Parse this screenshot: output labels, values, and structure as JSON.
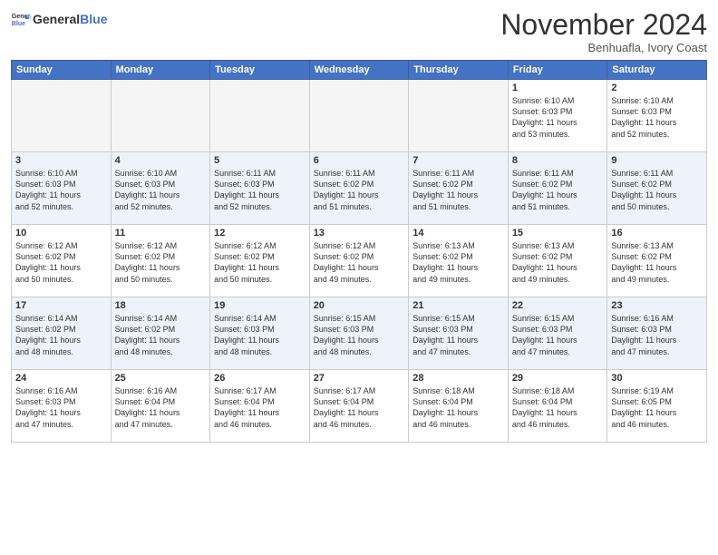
{
  "header": {
    "logo_line1": "General",
    "logo_line2": "Blue",
    "month": "November 2024",
    "location": "Benhuafla, Ivory Coast"
  },
  "weekdays": [
    "Sunday",
    "Monday",
    "Tuesday",
    "Wednesday",
    "Thursday",
    "Friday",
    "Saturday"
  ],
  "weeks": [
    [
      {
        "day": "",
        "info": ""
      },
      {
        "day": "",
        "info": ""
      },
      {
        "day": "",
        "info": ""
      },
      {
        "day": "",
        "info": ""
      },
      {
        "day": "",
        "info": ""
      },
      {
        "day": "1",
        "info": "Sunrise: 6:10 AM\nSunset: 6:03 PM\nDaylight: 11 hours\nand 53 minutes."
      },
      {
        "day": "2",
        "info": "Sunrise: 6:10 AM\nSunset: 6:03 PM\nDaylight: 11 hours\nand 52 minutes."
      }
    ],
    [
      {
        "day": "3",
        "info": "Sunrise: 6:10 AM\nSunset: 6:03 PM\nDaylight: 11 hours\nand 52 minutes."
      },
      {
        "day": "4",
        "info": "Sunrise: 6:10 AM\nSunset: 6:03 PM\nDaylight: 11 hours\nand 52 minutes."
      },
      {
        "day": "5",
        "info": "Sunrise: 6:11 AM\nSunset: 6:03 PM\nDaylight: 11 hours\nand 52 minutes."
      },
      {
        "day": "6",
        "info": "Sunrise: 6:11 AM\nSunset: 6:02 PM\nDaylight: 11 hours\nand 51 minutes."
      },
      {
        "day": "7",
        "info": "Sunrise: 6:11 AM\nSunset: 6:02 PM\nDaylight: 11 hours\nand 51 minutes."
      },
      {
        "day": "8",
        "info": "Sunrise: 6:11 AM\nSunset: 6:02 PM\nDaylight: 11 hours\nand 51 minutes."
      },
      {
        "day": "9",
        "info": "Sunrise: 6:11 AM\nSunset: 6:02 PM\nDaylight: 11 hours\nand 50 minutes."
      }
    ],
    [
      {
        "day": "10",
        "info": "Sunrise: 6:12 AM\nSunset: 6:02 PM\nDaylight: 11 hours\nand 50 minutes."
      },
      {
        "day": "11",
        "info": "Sunrise: 6:12 AM\nSunset: 6:02 PM\nDaylight: 11 hours\nand 50 minutes."
      },
      {
        "day": "12",
        "info": "Sunrise: 6:12 AM\nSunset: 6:02 PM\nDaylight: 11 hours\nand 50 minutes."
      },
      {
        "day": "13",
        "info": "Sunrise: 6:12 AM\nSunset: 6:02 PM\nDaylight: 11 hours\nand 49 minutes."
      },
      {
        "day": "14",
        "info": "Sunrise: 6:13 AM\nSunset: 6:02 PM\nDaylight: 11 hours\nand 49 minutes."
      },
      {
        "day": "15",
        "info": "Sunrise: 6:13 AM\nSunset: 6:02 PM\nDaylight: 11 hours\nand 49 minutes."
      },
      {
        "day": "16",
        "info": "Sunrise: 6:13 AM\nSunset: 6:02 PM\nDaylight: 11 hours\nand 49 minutes."
      }
    ],
    [
      {
        "day": "17",
        "info": "Sunrise: 6:14 AM\nSunset: 6:02 PM\nDaylight: 11 hours\nand 48 minutes."
      },
      {
        "day": "18",
        "info": "Sunrise: 6:14 AM\nSunset: 6:02 PM\nDaylight: 11 hours\nand 48 minutes."
      },
      {
        "day": "19",
        "info": "Sunrise: 6:14 AM\nSunset: 6:03 PM\nDaylight: 11 hours\nand 48 minutes."
      },
      {
        "day": "20",
        "info": "Sunrise: 6:15 AM\nSunset: 6:03 PM\nDaylight: 11 hours\nand 48 minutes."
      },
      {
        "day": "21",
        "info": "Sunrise: 6:15 AM\nSunset: 6:03 PM\nDaylight: 11 hours\nand 47 minutes."
      },
      {
        "day": "22",
        "info": "Sunrise: 6:15 AM\nSunset: 6:03 PM\nDaylight: 11 hours\nand 47 minutes."
      },
      {
        "day": "23",
        "info": "Sunrise: 6:16 AM\nSunset: 6:03 PM\nDaylight: 11 hours\nand 47 minutes."
      }
    ],
    [
      {
        "day": "24",
        "info": "Sunrise: 6:16 AM\nSunset: 6:03 PM\nDaylight: 11 hours\nand 47 minutes."
      },
      {
        "day": "25",
        "info": "Sunrise: 6:16 AM\nSunset: 6:04 PM\nDaylight: 11 hours\nand 47 minutes."
      },
      {
        "day": "26",
        "info": "Sunrise: 6:17 AM\nSunset: 6:04 PM\nDaylight: 11 hours\nand 46 minutes."
      },
      {
        "day": "27",
        "info": "Sunrise: 6:17 AM\nSunset: 6:04 PM\nDaylight: 11 hours\nand 46 minutes."
      },
      {
        "day": "28",
        "info": "Sunrise: 6:18 AM\nSunset: 6:04 PM\nDaylight: 11 hours\nand 46 minutes."
      },
      {
        "day": "29",
        "info": "Sunrise: 6:18 AM\nSunset: 6:04 PM\nDaylight: 11 hours\nand 46 minutes."
      },
      {
        "day": "30",
        "info": "Sunrise: 6:19 AM\nSunset: 6:05 PM\nDaylight: 11 hours\nand 46 minutes."
      }
    ]
  ]
}
